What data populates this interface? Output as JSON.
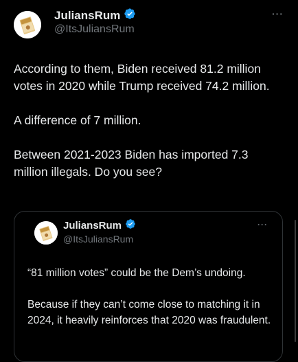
{
  "post": {
    "author_name": "JuliansRum",
    "author_handle": "@ItsJuliansRum",
    "more_label": "···",
    "paragraphs": [
      "According to them, Biden received 81.2 million votes in 2020 while Trump received 74.2 million.",
      "A difference of 7 million.",
      "Between 2021-2023 Biden has imported 7.3 million illegals. Do you see?"
    ]
  },
  "quoted_post": {
    "author_name": "JuliansRum",
    "author_handle": "@ItsJuliansRum",
    "more_label": "···",
    "paragraphs": [
      "“81 million votes” could be the Dem’s undoing.",
      "Because if they can’t come close to matching it in 2024, it heavily reinforces that 2020 was fraudulent."
    ]
  },
  "colors": {
    "background": "#000000",
    "text": "#e7e9ea",
    "secondary_text": "#71767b",
    "verified_badge": "#1d9bf0",
    "border": "#2f3336"
  },
  "icons": {
    "verified": "verified-badge-icon",
    "more": "more-options-icon"
  }
}
